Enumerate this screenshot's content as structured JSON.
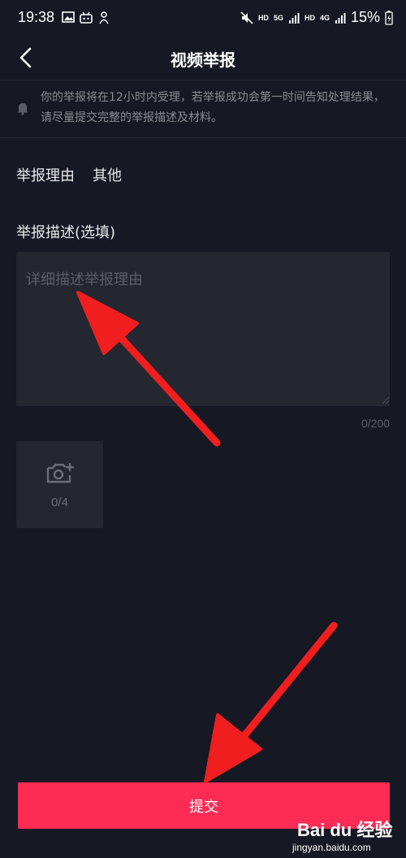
{
  "status_bar": {
    "time": "19:38",
    "hd1": "HD",
    "net1": "5G",
    "hd2": "HD",
    "net2": "4G",
    "battery": "15%"
  },
  "header": {
    "title": "视频举报"
  },
  "notice": {
    "text": "你的举报将在12小时内受理，若举报成功会第一时间告知处理结果，请尽量提交完整的举报描述及材料。"
  },
  "reason": {
    "label": "举报理由",
    "value": "其他"
  },
  "description": {
    "label": "举报描述(选填)",
    "placeholder": "详细描述举报理由",
    "value": "",
    "counter": "0/200"
  },
  "upload": {
    "count": "0/4"
  },
  "submit": {
    "label": "提交"
  },
  "watermark": {
    "main": "Bai du 经验",
    "sub": "jingyan.baidu.com"
  },
  "colors": {
    "background": "#161823",
    "accent": "#fe2c55",
    "annotation_arrow": "#f01e1e"
  }
}
